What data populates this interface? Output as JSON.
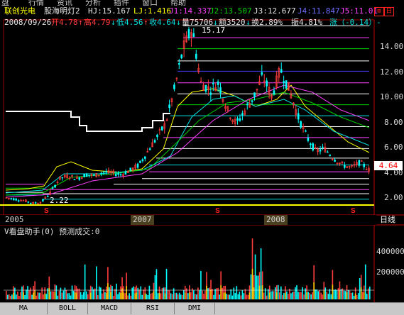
{
  "menu": [
    "盘",
    "行情",
    "资讯",
    "分析",
    "插件",
    "窗口",
    "帮助"
  ],
  "header1": {
    "name": "联创光电",
    "indicator": "股海明灯2",
    "hj": "HJ:15.167",
    "lj": "LJ:1.416",
    "j1": "J1:14.337",
    "j2": "J2:13.507",
    "j3": "J3:12.677",
    "j4": "J4:11.847",
    "j5": "J5:11.01"
  },
  "header2": {
    "date": "2008/09/26",
    "open": "开4.78",
    "open_arrow": "↑",
    "high": "高4.79",
    "high_arrow": "↓",
    "low": "低4.56",
    "low_arrow": "↑",
    "close": "收4.64",
    "close_arrow": "↓",
    "vol": "量75706",
    "vol_arrow": "↓",
    "amt": "额3520",
    "amt_arrow": "↓",
    "turnover": "换2.89%",
    "amp": "振4.81%",
    "chg": "涨（-0.14）-"
  },
  "price_axis": [
    "14.00",
    "12.00",
    "10.00",
    "8.00",
    "6.00",
    "4.00",
    "2.00"
  ],
  "high_label": "15.17",
  "low_label": "2.22",
  "last_price": "4.64",
  "dates": [
    "2005",
    "2007",
    "2008"
  ],
  "period_label": "日线",
  "volume": {
    "title": "V看盘助手(0) 预测成交:0",
    "axis": [
      "400000",
      "200000"
    ]
  },
  "tabs": [
    "MA",
    "BOLL",
    "MACD",
    "RSI",
    "DMI"
  ],
  "colors": {
    "up": "#ff3c3c",
    "down": "#00ffff",
    "bg": "#000000"
  },
  "chart_data": {
    "type": "line",
    "close": [
      2.6,
      2.5,
      2.4,
      2.2,
      2.3,
      3.0,
      4.0,
      4.2,
      4.0,
      4.3,
      4.2,
      4.5,
      4.4,
      4.3,
      4.6,
      5.0,
      6.0,
      7.0,
      8.0,
      10.5,
      13.5,
      15.0,
      11.0,
      10.5,
      11.0,
      9.0,
      8.0,
      9.0,
      10.0,
      11.5,
      10.0,
      12.0,
      10.5,
      8.5,
      7.0,
      6.0,
      6.2,
      5.5,
      5.0,
      4.8,
      5.2,
      4.64
    ],
    "ylim": [
      1.5,
      15.5
    ]
  }
}
